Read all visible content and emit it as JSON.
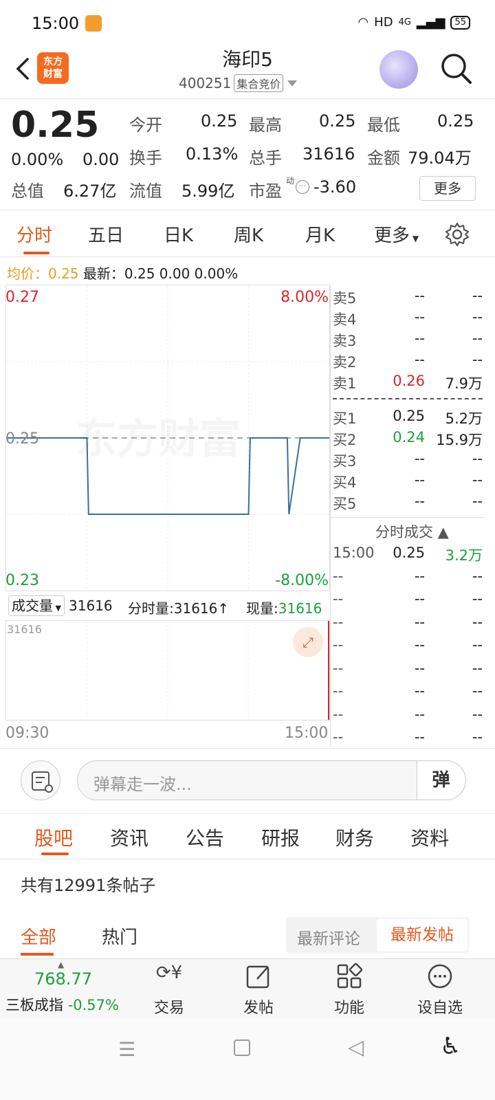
{
  "status": {
    "time": "15:00",
    "signal": "HD",
    "net": "4G",
    "battery": "55"
  },
  "nav": {
    "title": "海印5",
    "code": "400251",
    "tag": "集合竞价",
    "logo_l1": "东方",
    "logo_l2": "财富"
  },
  "quote": {
    "price": "0.25",
    "pct": "0.00%",
    "chg": "0.00",
    "open_l": "今开",
    "open": "0.25",
    "high_l": "最高",
    "high": "0.25",
    "low_l": "最低",
    "low": "0.25",
    "turn_l": "换手",
    "turn": "0.13%",
    "hand_l": "总手",
    "hand": "31616",
    "amt_l": "金额",
    "amt": "79.04万",
    "mcap_l": "总值",
    "mcap": "6.27亿",
    "fcap_l": "流值",
    "fcap": "5.99亿",
    "pe_l": "市盈",
    "pe_sup": "动",
    "pe": "-3.60",
    "more": "更多"
  },
  "tabs": [
    "分时",
    "五日",
    "日K",
    "周K",
    "月K",
    "更多"
  ],
  "avg": {
    "label": "均价：",
    "value": "0.25",
    "latest": "最新：0.25  0.00  0.00%"
  },
  "chart_data": {
    "type": "line",
    "title": "",
    "y_top": "0.27",
    "y_mid": "0.25",
    "y_bot": "0.23",
    "pct_top": "8.00%",
    "pct_bot": "-8.00%",
    "x_start": "09:30",
    "x_end": "15:00",
    "ylim": [
      0.23,
      0.27
    ],
    "series": [
      {
        "values": [
          0.25,
          0.25,
          0.24,
          0.24,
          0.24,
          0.24,
          0.24,
          0.25,
          0.25,
          0.25,
          0.25,
          0.24,
          0.25,
          0.25
        ]
      }
    ],
    "x_fraction": [
      0,
      0.25,
      0.255,
      0.3,
      0.5,
      0.7,
      0.75,
      0.755,
      0.8,
      0.85,
      0.87,
      0.875,
      0.91,
      1.0
    ],
    "watermark": "东方财富",
    "volume": {
      "label": "成交量",
      "total": "31616",
      "fs_label": "分时量:",
      "fs_value": "31616↑",
      "now_label": "现量:",
      "now_value": "31616",
      "axis_max": "31616"
    }
  },
  "orderbook": {
    "sell": [
      {
        "label": "卖5",
        "price": "--",
        "vol": "--"
      },
      {
        "label": "卖4",
        "price": "--",
        "vol": "--"
      },
      {
        "label": "卖3",
        "price": "--",
        "vol": "--"
      },
      {
        "label": "卖2",
        "price": "--",
        "vol": "--"
      },
      {
        "label": "卖1",
        "price": "0.26",
        "vol": "7.9万"
      }
    ],
    "buy": [
      {
        "label": "买1",
        "price": "0.25",
        "vol": "5.2万"
      },
      {
        "label": "买2",
        "price": "0.24",
        "vol": "15.9万"
      },
      {
        "label": "买3",
        "price": "--",
        "vol": "--"
      },
      {
        "label": "买4",
        "price": "--",
        "vol": "--"
      },
      {
        "label": "买5",
        "price": "--",
        "vol": "--"
      }
    ],
    "trades_title": "分时成交",
    "trades": [
      {
        "time": "15:00",
        "price": "0.25",
        "vol": "3.2万"
      },
      {
        "time": "--",
        "price": "--",
        "vol": "--"
      },
      {
        "time": "--",
        "price": "--",
        "vol": "--"
      },
      {
        "time": "--",
        "price": "--",
        "vol": "--"
      },
      {
        "time": "--",
        "price": "--",
        "vol": "--"
      },
      {
        "time": "--",
        "price": "--",
        "vol": "--"
      },
      {
        "time": "--",
        "price": "--",
        "vol": "--"
      },
      {
        "time": "--",
        "price": "--",
        "vol": "--"
      },
      {
        "time": "--",
        "price": "--",
        "vol": "--"
      }
    ]
  },
  "danmu": {
    "placeholder": "弹幕走一波...",
    "btn": "弹"
  },
  "btabs": [
    "股吧",
    "资讯",
    "公告",
    "研报",
    "财务",
    "资料"
  ],
  "posts": {
    "count": "共有12991条帖子",
    "tab_all": "全部",
    "tab_hot": "热门",
    "seg_a": "最新评论",
    "seg_b": "最新发帖"
  },
  "bottom": {
    "index_value": "768.77",
    "index_name": "三板成指",
    "index_pct": "-0.57%",
    "trade": "交易",
    "post": "发帖",
    "func": "功能",
    "watch": "设自选"
  }
}
